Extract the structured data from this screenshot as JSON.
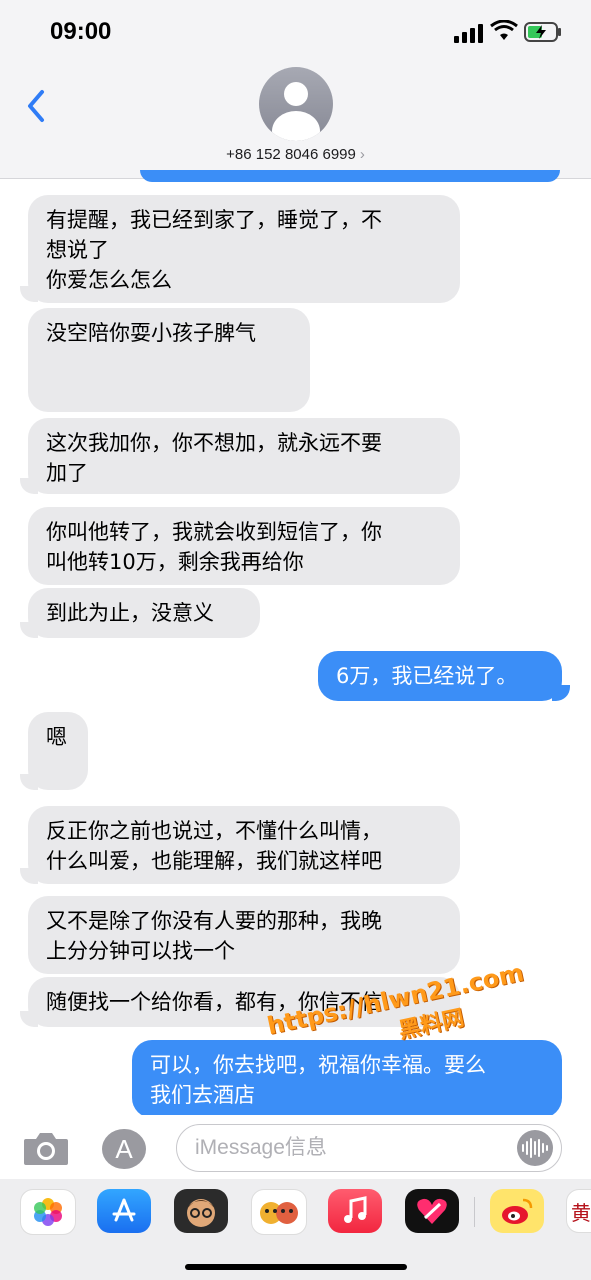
{
  "status_bar": {
    "time": "09:00"
  },
  "header": {
    "contact": "+86 152 8046 6999",
    "chevron": "›"
  },
  "messages": [
    {
      "dir": "in",
      "text": "有提醒，我已经到家了，睡觉了，不\n想说了\n你爱怎么怎么"
    },
    {
      "dir": "in",
      "text": "没空陪你耍小孩子脾气"
    },
    {
      "dir": "in",
      "text": "这次我加你，你不想加，就永远不要\n加了"
    },
    {
      "dir": "in",
      "text": "你叫他转了，我就会收到短信了，你\n叫他转10万，剩余我再给你"
    },
    {
      "dir": "in",
      "text": "到此为止，没意义"
    },
    {
      "dir": "out",
      "text": "6万，我已经说了。"
    },
    {
      "dir": "in",
      "text": "嗯"
    },
    {
      "dir": "in",
      "text": "反正你之前也说过，不懂什么叫情，\n什么叫爱，也能理解，我们就这样吧"
    },
    {
      "dir": "in",
      "text": "又不是除了你没有人要的那种，我晚\n上分分钟可以找一个"
    },
    {
      "dir": "in",
      "text": "随便找一个给你看，都有，你信不信"
    },
    {
      "dir": "out",
      "text": "可以，你去找吧，祝福你幸福。要么\n我们去酒店"
    }
  ],
  "watermark": {
    "line1": "https://hlwn21.com",
    "line2": "黑料网"
  },
  "input": {
    "placeholder": "iMessage信息",
    "apps_glyph": "A"
  },
  "drawer": {
    "partial_label": "黄",
    "icons": [
      "photos-icon",
      "app-store-icon",
      "memoji-icon",
      "animoji-icon",
      "music-icon",
      "digital-touch-icon",
      "weibo-icon"
    ]
  },
  "colors": {
    "outgoing": "#3b8ef7",
    "incoming": "#e9e9eb",
    "bar": "#f4f4f6"
  }
}
